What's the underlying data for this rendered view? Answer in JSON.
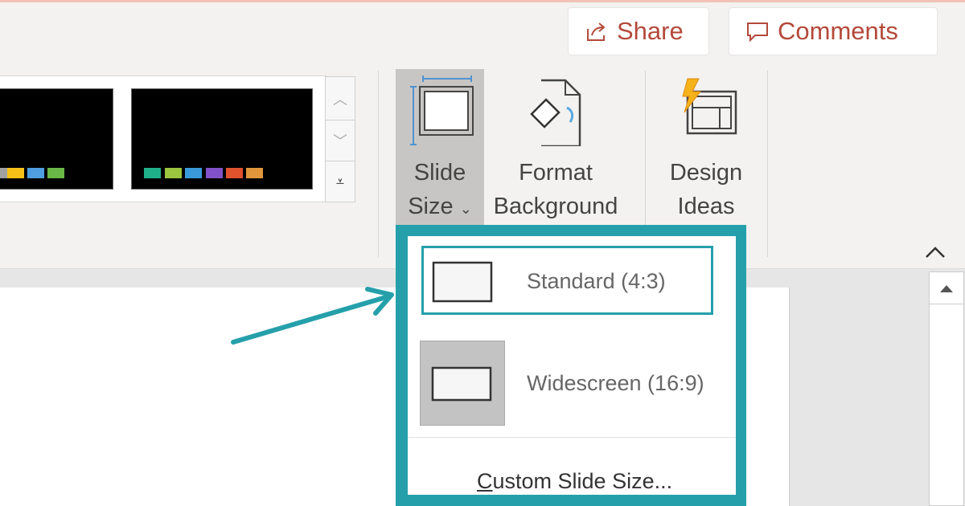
{
  "header": {
    "share_label": "Share",
    "comments_label": "Comments"
  },
  "themes_gallery": {
    "thumbnails": [
      {
        "swatches": [
          "#a0a0a0",
          "#f7c218",
          "#4f9ee0",
          "#6ab845"
        ]
      },
      {
        "swatches": [
          "#1fb08a",
          "#9bc43f",
          "#3a9ad9",
          "#8251c9",
          "#e0522c",
          "#e2963b"
        ]
      }
    ],
    "scroll_up_icon": "chevron-up",
    "scroll_down_icon": "chevron-down",
    "more_icon": "expand-gallery"
  },
  "ribbon": {
    "slide_size": {
      "line1": "Slide",
      "line2": "Size",
      "chevron": "⌄"
    },
    "format_background": {
      "line1": "Format",
      "line2": "Background"
    },
    "design_ideas": {
      "line1": "Design",
      "line2": "Ideas"
    },
    "collapse_icon": "^"
  },
  "dropdown": {
    "items": [
      {
        "label": "Standard (4:3)",
        "highlighted": true
      },
      {
        "label": "Widescreen (16:9)",
        "selected": true
      }
    ],
    "custom_label_first": "C",
    "custom_label_rest": "ustom Slide Size..."
  },
  "colors": {
    "accent": "#25a0ab",
    "brand": "#b4493a"
  }
}
